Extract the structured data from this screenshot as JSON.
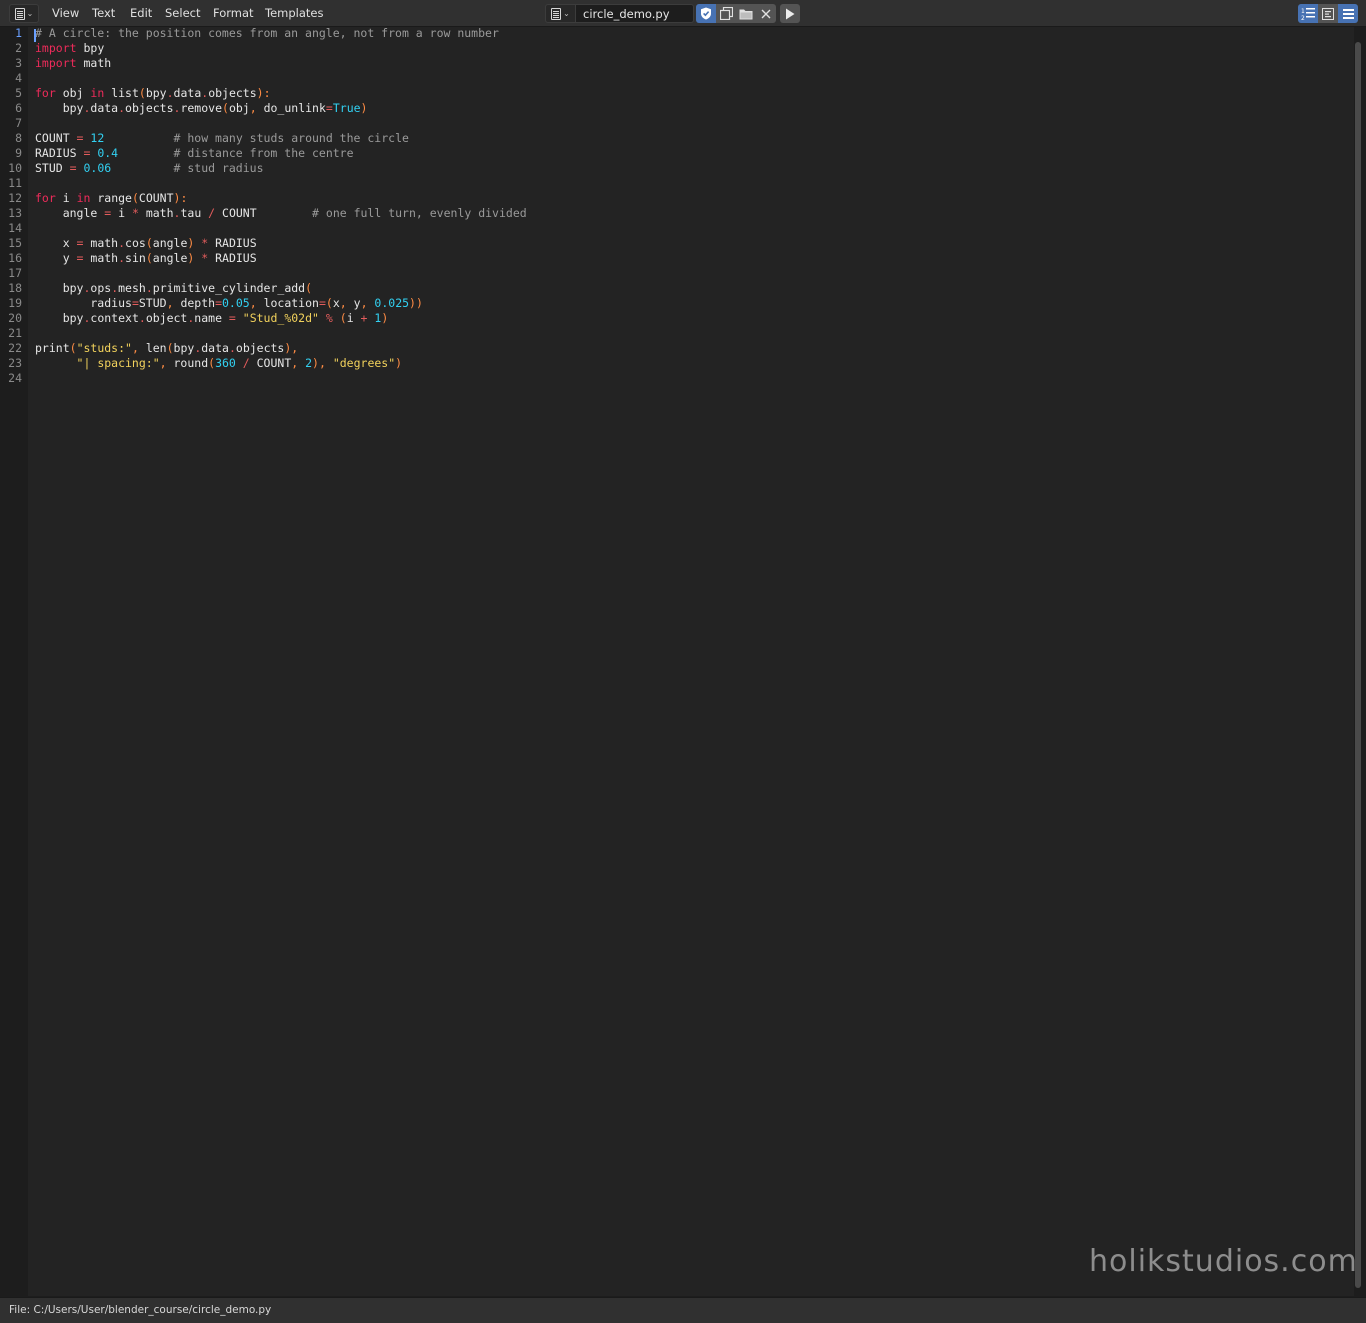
{
  "header": {
    "menus": [
      "View",
      "Text",
      "Edit",
      "Select",
      "Format",
      "Templates"
    ],
    "filename": "circle_demo.py"
  },
  "editor": {
    "active_line": 1,
    "line_numbers": [
      "1",
      "2",
      "3",
      "4",
      "5",
      "6",
      "7",
      "8",
      "9",
      "10",
      "11",
      "12",
      "13",
      "14",
      "15",
      "16",
      "17",
      "18",
      "19",
      "20",
      "21",
      "22",
      "23",
      "24"
    ],
    "lines": [
      [
        [
          "c",
          "# A circle: the position comes from an angle, not from a row number"
        ]
      ],
      [
        [
          "k",
          "import"
        ],
        [
          "t",
          " bpy"
        ]
      ],
      [
        [
          "k",
          "import"
        ],
        [
          "t",
          " math"
        ]
      ],
      [],
      [
        [
          "k",
          "for"
        ],
        [
          "t",
          " obj "
        ],
        [
          "k",
          "in"
        ],
        [
          "t",
          " list"
        ],
        [
          "p",
          "("
        ],
        [
          "t",
          "bpy"
        ],
        [
          "o",
          "."
        ],
        [
          "t",
          "data"
        ],
        [
          "o",
          "."
        ],
        [
          "t",
          "objects"
        ],
        [
          "p",
          "):"
        ]
      ],
      [
        [
          "t",
          "    bpy"
        ],
        [
          "o",
          "."
        ],
        [
          "t",
          "data"
        ],
        [
          "o",
          "."
        ],
        [
          "t",
          "objects"
        ],
        [
          "o",
          "."
        ],
        [
          "t",
          "remove"
        ],
        [
          "p",
          "("
        ],
        [
          "t",
          "obj"
        ],
        [
          "p",
          ","
        ],
        [
          "t",
          " do_unlink"
        ],
        [
          "o",
          "="
        ],
        [
          "n",
          "True"
        ],
        [
          "p",
          ")"
        ]
      ],
      [],
      [
        [
          "t",
          "COUNT "
        ],
        [
          "o",
          "="
        ],
        [
          "n",
          " 12"
        ],
        [
          "t",
          "          "
        ],
        [
          "c",
          "# how many studs around the circle"
        ]
      ],
      [
        [
          "t",
          "RADIUS "
        ],
        [
          "o",
          "="
        ],
        [
          "n",
          " 0.4"
        ],
        [
          "t",
          "        "
        ],
        [
          "c",
          "# distance from the centre"
        ]
      ],
      [
        [
          "t",
          "STUD "
        ],
        [
          "o",
          "="
        ],
        [
          "n",
          " 0.06"
        ],
        [
          "t",
          "         "
        ],
        [
          "c",
          "# stud radius"
        ]
      ],
      [],
      [
        [
          "k",
          "for"
        ],
        [
          "t",
          " i "
        ],
        [
          "k",
          "in"
        ],
        [
          "t",
          " range"
        ],
        [
          "p",
          "("
        ],
        [
          "t",
          "COUNT"
        ],
        [
          "p",
          "):"
        ]
      ],
      [
        [
          "t",
          "    angle "
        ],
        [
          "o",
          "="
        ],
        [
          "t",
          " i "
        ],
        [
          "o",
          "*"
        ],
        [
          "t",
          " math"
        ],
        [
          "o",
          "."
        ],
        [
          "t",
          "tau "
        ],
        [
          "o",
          "/"
        ],
        [
          "t",
          " COUNT"
        ],
        [
          "t",
          "        "
        ],
        [
          "c",
          "# one full turn, evenly divided"
        ]
      ],
      [],
      [
        [
          "t",
          "    x "
        ],
        [
          "o",
          "="
        ],
        [
          "t",
          " math"
        ],
        [
          "o",
          "."
        ],
        [
          "t",
          "cos"
        ],
        [
          "p",
          "("
        ],
        [
          "t",
          "angle"
        ],
        [
          "p",
          ")"
        ],
        [
          "o",
          " *"
        ],
        [
          "t",
          " RADIUS"
        ]
      ],
      [
        [
          "t",
          "    y "
        ],
        [
          "o",
          "="
        ],
        [
          "t",
          " math"
        ],
        [
          "o",
          "."
        ],
        [
          "t",
          "sin"
        ],
        [
          "p",
          "("
        ],
        [
          "t",
          "angle"
        ],
        [
          "p",
          ")"
        ],
        [
          "o",
          " *"
        ],
        [
          "t",
          " RADIUS"
        ]
      ],
      [],
      [
        [
          "t",
          "    bpy"
        ],
        [
          "o",
          "."
        ],
        [
          "t",
          "ops"
        ],
        [
          "o",
          "."
        ],
        [
          "t",
          "mesh"
        ],
        [
          "o",
          "."
        ],
        [
          "t",
          "primitive_cylinder_add"
        ],
        [
          "p",
          "("
        ]
      ],
      [
        [
          "t",
          "        radius"
        ],
        [
          "o",
          "="
        ],
        [
          "t",
          "STUD"
        ],
        [
          "p",
          ","
        ],
        [
          "t",
          " depth"
        ],
        [
          "o",
          "="
        ],
        [
          "n",
          "0.05"
        ],
        [
          "p",
          ","
        ],
        [
          "t",
          " location"
        ],
        [
          "o",
          "="
        ],
        [
          "p",
          "("
        ],
        [
          "t",
          "x"
        ],
        [
          "p",
          ","
        ],
        [
          "t",
          " y"
        ],
        [
          "p",
          ","
        ],
        [
          "n",
          " 0.025"
        ],
        [
          "p",
          "))"
        ]
      ],
      [
        [
          "t",
          "    bpy"
        ],
        [
          "o",
          "."
        ],
        [
          "t",
          "context"
        ],
        [
          "o",
          "."
        ],
        [
          "t",
          "object"
        ],
        [
          "o",
          "."
        ],
        [
          "t",
          "name "
        ],
        [
          "o",
          "="
        ],
        [
          "s",
          " \"Stud_%02d\""
        ],
        [
          "o",
          " %"
        ],
        [
          "t",
          " "
        ],
        [
          "p",
          "("
        ],
        [
          "t",
          "i "
        ],
        [
          "o",
          "+"
        ],
        [
          "n",
          " 1"
        ],
        [
          "p",
          ")"
        ]
      ],
      [],
      [
        [
          "t",
          "print"
        ],
        [
          "p",
          "("
        ],
        [
          "s",
          "\"studs:\""
        ],
        [
          "p",
          ","
        ],
        [
          "t",
          " len"
        ],
        [
          "p",
          "("
        ],
        [
          "t",
          "bpy"
        ],
        [
          "o",
          "."
        ],
        [
          "t",
          "data"
        ],
        [
          "o",
          "."
        ],
        [
          "t",
          "objects"
        ],
        [
          "p",
          "),"
        ]
      ],
      [
        [
          "t",
          "      "
        ],
        [
          "s",
          "\"| spacing:\""
        ],
        [
          "p",
          ","
        ],
        [
          "t",
          " round"
        ],
        [
          "p",
          "("
        ],
        [
          "n",
          "360"
        ],
        [
          "o",
          " /"
        ],
        [
          "t",
          " COUNT"
        ],
        [
          "p",
          ","
        ],
        [
          "n",
          " 2"
        ],
        [
          "p",
          "),"
        ],
        [
          "s",
          " \"degrees\""
        ],
        [
          "p",
          ")"
        ]
      ],
      []
    ]
  },
  "watermark": "holikstudios.com",
  "status": {
    "text": "File: C:/Users/User/blender_course/circle_demo.py"
  }
}
